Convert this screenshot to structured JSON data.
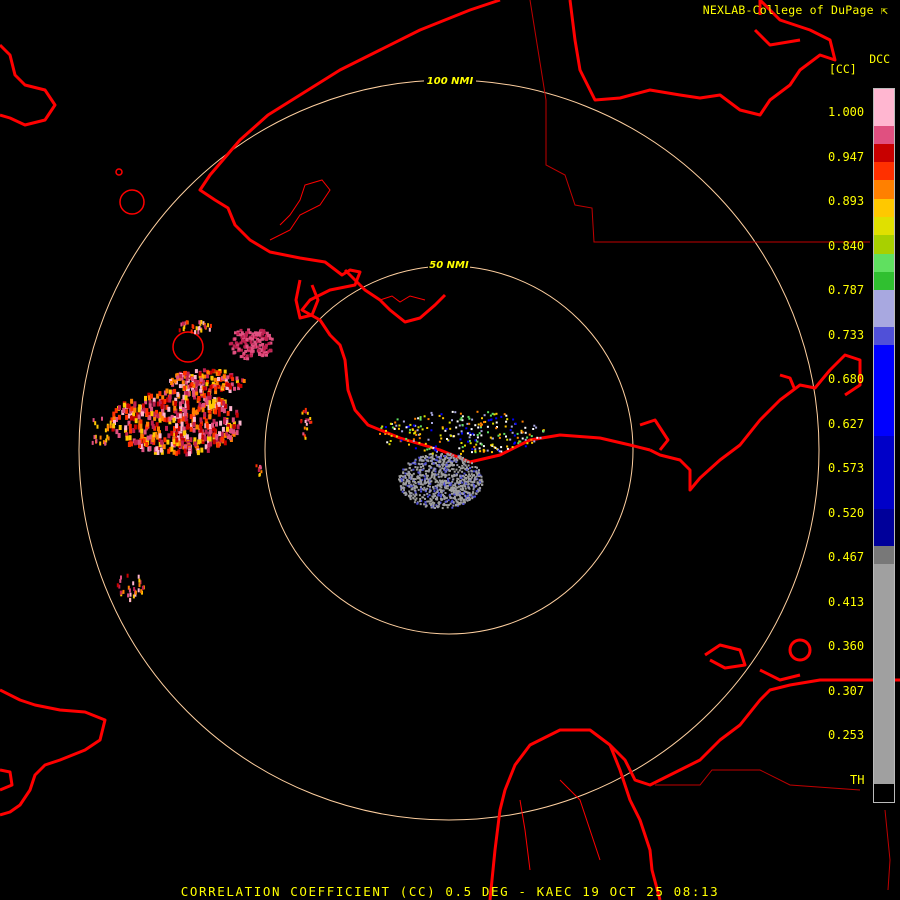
{
  "header": {
    "credit": "NEXLAB-College of DuPage",
    "product_code": "DCC",
    "product_name": "[CC]"
  },
  "range_rings": [
    {
      "label": "50 NMI"
    },
    {
      "label": "100 NMI"
    }
  ],
  "legend": {
    "ticks": [
      "1.000",
      "0.947",
      "0.893",
      "0.840",
      "0.787",
      "0.733",
      "0.680",
      "0.627",
      "0.573",
      "0.520",
      "0.467",
      "0.413",
      "0.360",
      "0.307",
      "0.253",
      "TH"
    ],
    "colors": [
      "#ffb6d0",
      "#e05080",
      "#c80000",
      "#ff3000",
      "#ff8000",
      "#ffc800",
      "#e0e000",
      "#a8d000",
      "#60e060",
      "#30c030",
      "#a8a8e0",
      "#5050d8",
      "#0000ff",
      "#0000c8",
      "#00009a",
      "#787878",
      "#a0a0a0",
      "#000000"
    ]
  },
  "footer": {
    "caption": "CORRELATION COEFFICIENT (CC) 0.5 DEG - KAEC 19 OCT 25 08:13"
  },
  "colors": {
    "coastline": "#ff0000",
    "border": "#c00000",
    "ring": "#ffd0a0",
    "text": "#ffff00"
  }
}
